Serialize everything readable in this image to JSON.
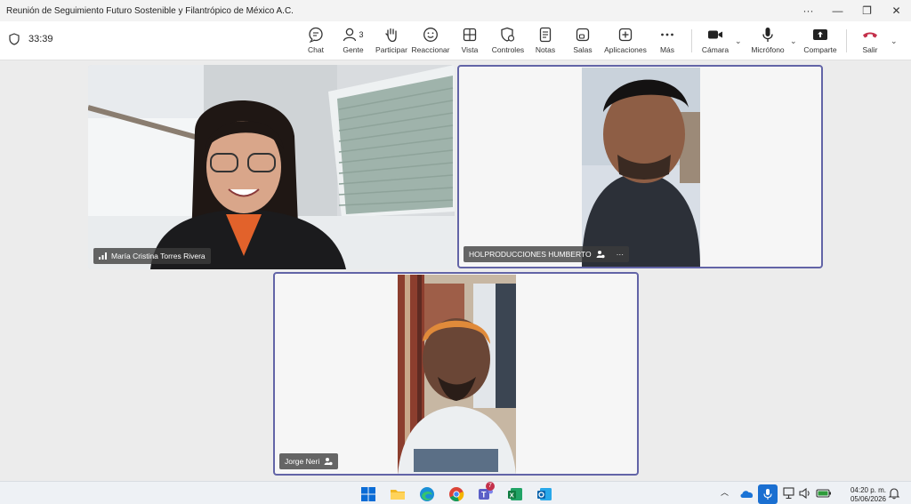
{
  "window": {
    "title": "Reunión de Seguimiento Futuro Sostenible y Filantrópico de México A.C.",
    "controls": {
      "more": "···",
      "minimize": "—",
      "restore": "❐",
      "close": "✕"
    }
  },
  "toolbar": {
    "timer": "33:39",
    "chat": "Chat",
    "people": "Gente",
    "people_count": "3",
    "raise": "Participar",
    "react": "Reaccionar",
    "view": "Vista",
    "controls": "Controles",
    "notes": "Notas",
    "rooms": "Salas",
    "apps": "Aplicaciones",
    "more": "Más",
    "camera": "Cámara",
    "mic": "Micrófono",
    "share": "Comparte",
    "leave": "Salir",
    "leave_color": "#c4314b"
  },
  "participants": {
    "p1": {
      "name": "María Cristina Torres Rivera"
    },
    "p2": {
      "name": "HOLPRODUCCIONES HUMBERTO",
      "more": "···"
    },
    "p3": {
      "name": "Jorge Neri"
    }
  },
  "taskbar": {
    "teams_badge": "7",
    "time": "04:20 p. m.",
    "date": "05/06/2026"
  },
  "colors": {
    "accent": "#6264a7"
  }
}
